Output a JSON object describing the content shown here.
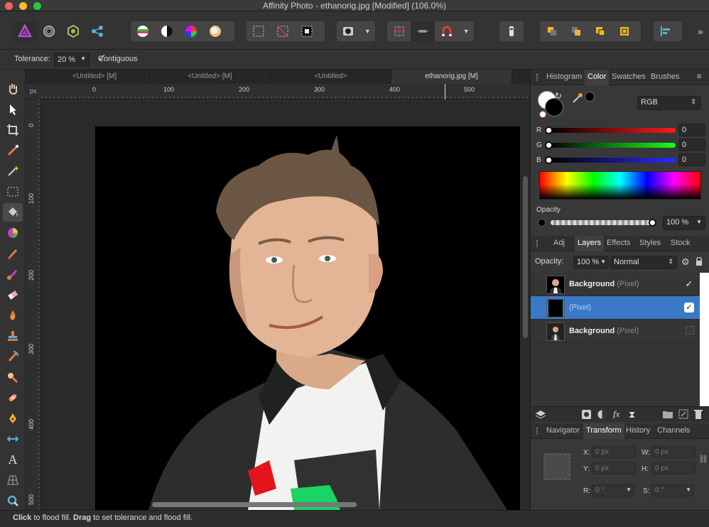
{
  "app": {
    "title": "Affinity Photo - ethanorig.jpg [Modified] (106.0%)"
  },
  "context_bar": {
    "tolerance_label": "Tolerance:",
    "tolerance_value": "20 %",
    "contiguous_label": "Contiguous"
  },
  "doc_tabs": [
    "<Untitled> [M]",
    "<Untitled> [M]",
    "<Untitled>",
    "ethanorig.jpg [M]"
  ],
  "ruler": {
    "unit": "px",
    "h_ticks": [
      "0",
      "100",
      "200",
      "300",
      "400",
      "500"
    ],
    "v_ticks": [
      "0",
      "100",
      "200",
      "300",
      "400",
      "500"
    ]
  },
  "color_panel": {
    "tabs": [
      "Histogram",
      "Color",
      "Swatches",
      "Brushes"
    ],
    "mode": "RGB",
    "channels": [
      {
        "label": "R",
        "value": "0"
      },
      {
        "label": "G",
        "value": "0"
      },
      {
        "label": "B",
        "value": "0"
      }
    ],
    "opacity_label": "Opacity",
    "opacity_value": "100 %"
  },
  "layers_panel": {
    "tabs": [
      "Adj",
      "Layers",
      "Effects",
      "Styles",
      "Stock"
    ],
    "opacity_label": "Opacity:",
    "opacity_value": "100 %",
    "blend_mode": "Normal",
    "layers": [
      {
        "name": "Background",
        "type": "(Pixel)",
        "checked": true,
        "selected": false
      },
      {
        "name": "",
        "type": "(Pixel)",
        "checked": true,
        "selected": true
      },
      {
        "name": "Background",
        "type": "(Pixel)",
        "checked": false,
        "selected": false
      }
    ]
  },
  "transform_panel": {
    "tabs": [
      "Navigator",
      "Transform",
      "History",
      "Channels"
    ],
    "x_label": "X:",
    "x_value": "0 px",
    "y_label": "Y:",
    "y_value": "0 px",
    "w_label": "W:",
    "w_value": "0 px",
    "h_label": "H:",
    "h_value": "0 px",
    "r_label": "R:",
    "r_value": "0 °",
    "s_label": "S:",
    "s_value": "0 °"
  },
  "status": {
    "click": "Click",
    "click_text": " to flood fill. ",
    "drag": "Drag",
    "drag_text": " to set tolerance and flood fill."
  }
}
